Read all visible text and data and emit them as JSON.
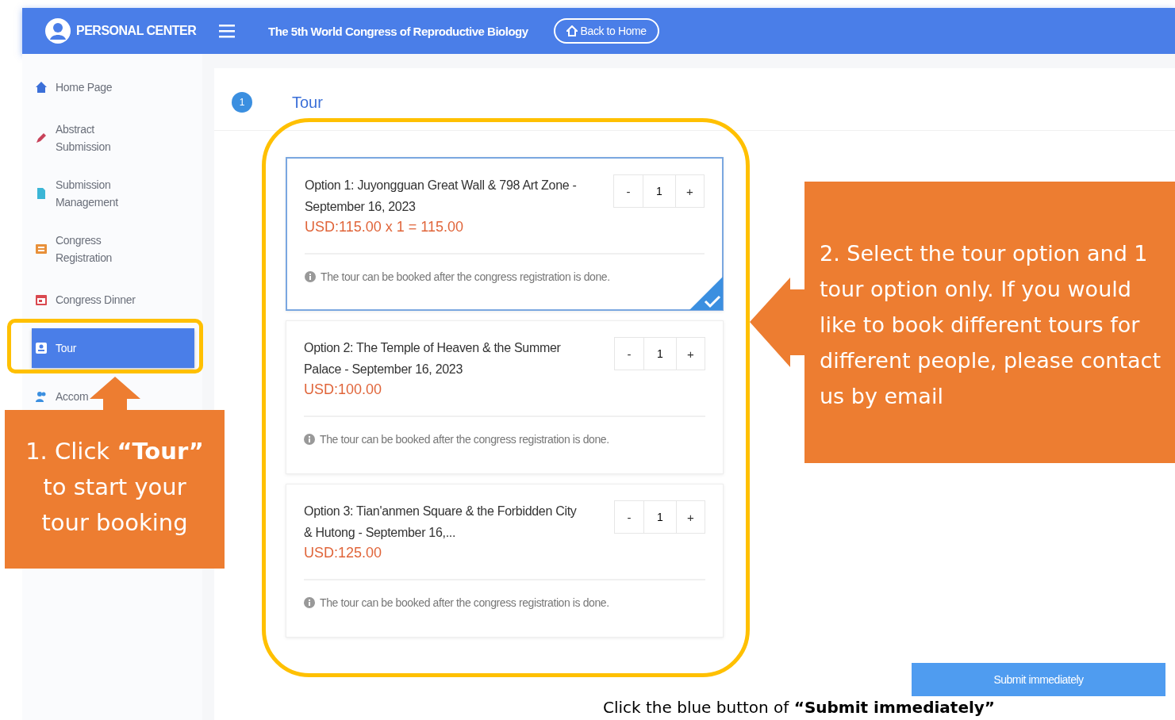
{
  "header": {
    "title": "PERSONAL CENTER",
    "conference": "The 5th World Congress of Reproductive Biology",
    "back_button": "Back to Home"
  },
  "sidebar": {
    "items": [
      {
        "label": "Home Page",
        "kind": "home",
        "selected": false
      },
      {
        "label": "Abstract Submission",
        "kind": "pen",
        "selected": false
      },
      {
        "label": "Submission Management",
        "kind": "document",
        "selected": false
      },
      {
        "label": "Congress Registration",
        "kind": "card",
        "selected": false
      },
      {
        "label": "Congress Dinner",
        "kind": "dinner",
        "selected": false
      },
      {
        "label": "Tour",
        "kind": "tour",
        "selected": true
      },
      {
        "label": "Accom",
        "kind": "people",
        "selected": false
      }
    ]
  },
  "section": {
    "step": "1",
    "title": "Tour"
  },
  "options": [
    {
      "title": "Option 1: Juyongguan Great Wall & 798 Art Zone - September 16, 2023",
      "price": "USD:115.00 x 1 = 115.00",
      "minus": "-",
      "quantity": "1",
      "plus": "+",
      "note": "The tour can be booked after the congress registration is done.",
      "selected": true
    },
    {
      "title": "Option 2: The Temple of Heaven & the Summer Palace - September 16, 2023",
      "price": "USD:100.00",
      "minus": "-",
      "quantity": "1",
      "plus": "+",
      "note": "The tour can be booked after the congress registration is done.",
      "selected": false
    },
    {
      "title": "Option 3: Tian'anmen Square & the Forbidden City & Hutong - September 16,...",
      "price": "USD:125.00",
      "minus": "-",
      "quantity": "1",
      "plus": "+",
      "note": "The tour can be booked after the congress registration is done.",
      "selected": false
    }
  ],
  "submit_button": "Submit immediately",
  "callouts": [
    {
      "text": "1. Click **“Tour”** to start your tour booking"
    },
    {
      "text": "2.  Select the tour option and 1 tour option only. If you would like to book different tours for different people, please contact us by email"
    }
  ],
  "footer_note": "Click the blue button of **“Submit immediately”**"
}
